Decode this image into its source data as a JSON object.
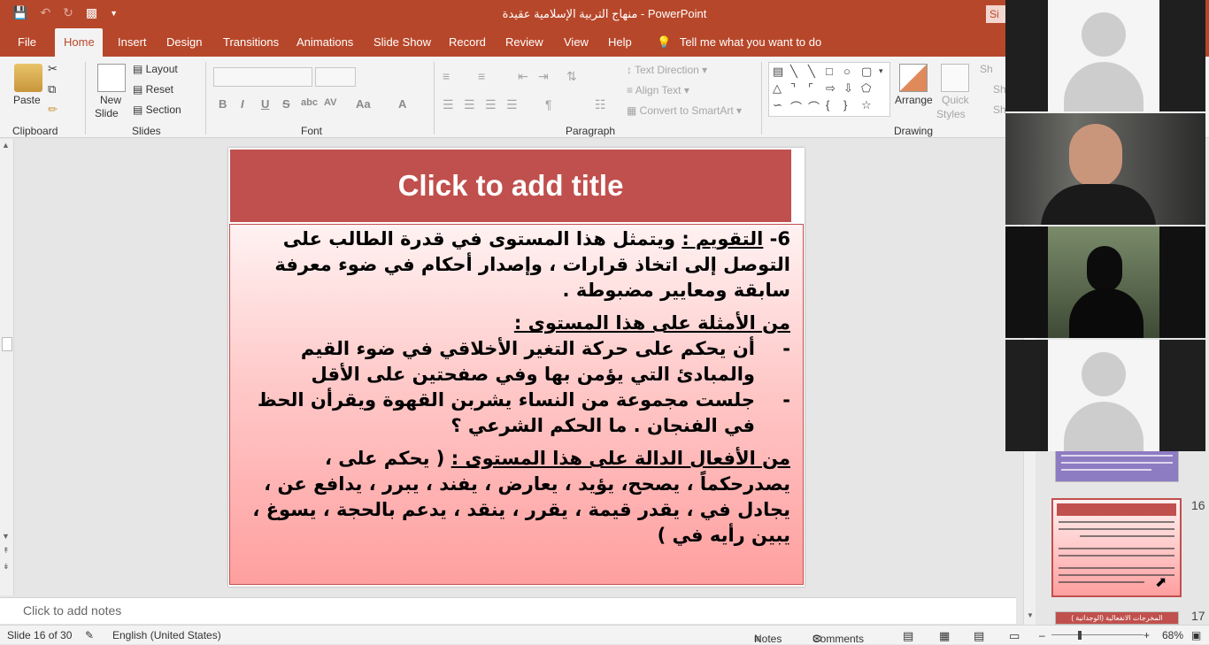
{
  "window": {
    "doc_title": "منهاج التربية الإسلامية عقيدة  -  PowerPoint",
    "signin_label": "Si"
  },
  "tabs": [
    "File",
    "Home",
    "Insert",
    "Design",
    "Transitions",
    "Animations",
    "Slide Show",
    "Record",
    "Review",
    "View",
    "Help",
    "Tell me what you want to do"
  ],
  "ribbon": {
    "clipboard": {
      "paste": "Paste",
      "label": "Clipboard"
    },
    "slides": {
      "new_slide_1": "New",
      "new_slide_2": "Slide",
      "layout": "Layout",
      "reset": "Reset",
      "section": "Section",
      "label": "Slides"
    },
    "font": {
      "label": "Font",
      "buttons": [
        "B",
        "I",
        "U",
        "S",
        "abc",
        "AV",
        "Aa",
        "A"
      ]
    },
    "paragraph": {
      "text_direction": "Text Direction",
      "align_text": "Align Text",
      "convert_smartart": "Convert to SmartArt",
      "label": "Paragraph"
    },
    "drawing": {
      "arrange": "Arrange",
      "quick_styles_1": "Quick",
      "quick_styles_2": "Styles",
      "label": "Drawing",
      "shape_fill": "Sh"
    }
  },
  "slide": {
    "title_placeholder": "Click to add title",
    "para1_num": "6- ",
    "para1_term": "التقويم :",
    "para1_rest": " ويتمثل هذا المستوى في قدرة الطالب على التوصل إلى اتخاذ قرارات ، وإصدار أحكام في ضوء معرفة سابقة ومعايير مضبوطة .",
    "examples_heading": "من الأمثلة على هذا المستوى :",
    "bullet_dash": "-",
    "bullet1": "أن يحكم على حركة التغير الأخلاقي في ضوء القيم والمبادئ التي يؤمن بها وفي صفحتين على الأقل",
    "bullet2": "جلست مجموعة من النساء يشربن القهوة ويقرأن الحظ في الفنجان . ما الحكم الشرعي ؟",
    "verbs_heading": "من الأفعال الدالة على هذا المستوى :",
    "verbs_text": " ( يحكم على ، يصدرحكماً ، يصحح، يؤيد ، يعارض ، يفند ، يبرر ، يدافع عن ، يجادل في ، يقدر قيمة ، يقرر ، ينقد ، يدعم بالحجة ، يسوغ ، يبين رأيه في )"
  },
  "notes_placeholder": "Click to add notes",
  "thumbnails": {
    "current": "16",
    "next": "17",
    "next_title": "المخرجات الانفعالية (الوجدانية )"
  },
  "status": {
    "slide_info": "Slide 16 of 30",
    "language": "English (United States)",
    "notes": "Notes",
    "comments": "Comments",
    "zoom": "68%"
  },
  "colors": {
    "accent": "#b7472a",
    "slide_title_bg": "#c0504d"
  }
}
